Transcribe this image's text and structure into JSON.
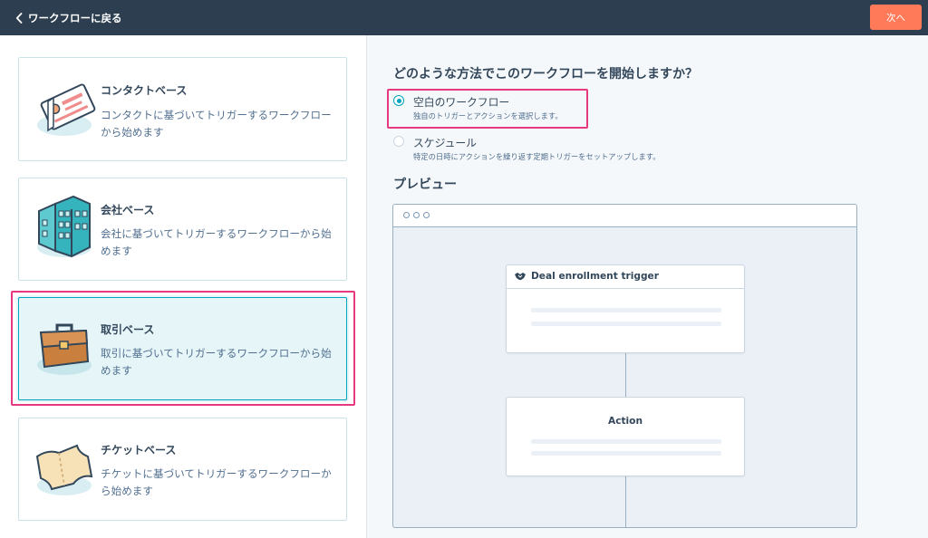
{
  "topbar": {
    "back_label": "ワークフローに戻る",
    "next_label": "次へ",
    "colors": {
      "bar": "#2d3e50",
      "next_button": "#ff7a59"
    }
  },
  "cards": [
    {
      "title": "コンタクトベース",
      "desc": "コンタクトに基づいてトリガーするワークフローから始めます",
      "icon": "contact-card-icon",
      "selected": false
    },
    {
      "title": "会社ベース",
      "desc": "会社に基づいてトリガーするワークフローから始めます",
      "icon": "building-icon",
      "selected": false
    },
    {
      "title": "取引ベース",
      "desc": "取引に基づいてトリガーするワークフローから始めます",
      "icon": "briefcase-icon",
      "selected": true
    },
    {
      "title": "チケットベース",
      "desc": "チケットに基づいてトリガーするワークフローから始めます",
      "icon": "ticket-icon",
      "selected": false
    }
  ],
  "main": {
    "question": "どのような方法でこのワークフローを開始しますか？",
    "options": [
      {
        "label": "空白のワークフロー",
        "sub": "独自のトリガーとアクションを選択します。",
        "selected": true
      },
      {
        "label": "スケジュール",
        "sub": "特定の日時にアクションを繰り返す定期トリガーをセットアップします。",
        "selected": false
      }
    ],
    "preview_title": "プレビュー",
    "preview": {
      "trigger_label": "Deal enrollment trigger",
      "trigger_icon": "handshake-icon",
      "action_label": "Action"
    }
  },
  "colors": {
    "accent": "#00a4bd",
    "highlight": "#e6397f",
    "selected_card_bg": "#e5f5f8"
  }
}
